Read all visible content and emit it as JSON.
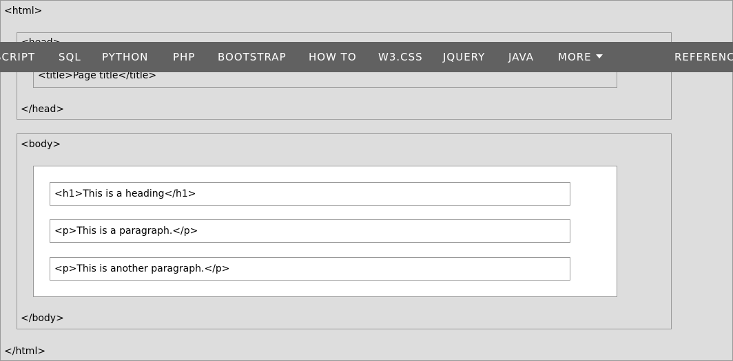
{
  "diagram": {
    "html_open": "<html>",
    "html_close": "</html>",
    "head_open": "<head>",
    "head_close": "</head>",
    "title_element": "<title>Page title</title>",
    "body_open": "<body>",
    "body_close": "</body>",
    "heading_element": "<h1>This is a heading</h1>",
    "paragraph_element": "<p>This is a paragraph.</p>",
    "paragraph2_element": "<p>This is another paragraph.</p>"
  },
  "nav": {
    "items": [
      "SCRIPT",
      "SQL",
      "PYTHON",
      "PHP",
      "BOOTSTRAP",
      "HOW TO",
      "W3.CSS",
      "JQUERY",
      "JAVA",
      "MORE",
      "REFERENC"
    ]
  },
  "colors": {
    "nav_background": "#616161",
    "nav_text": "#ffffff",
    "box_grey": "#dddddd",
    "box_white": "#ffffff",
    "border": "#999999"
  }
}
